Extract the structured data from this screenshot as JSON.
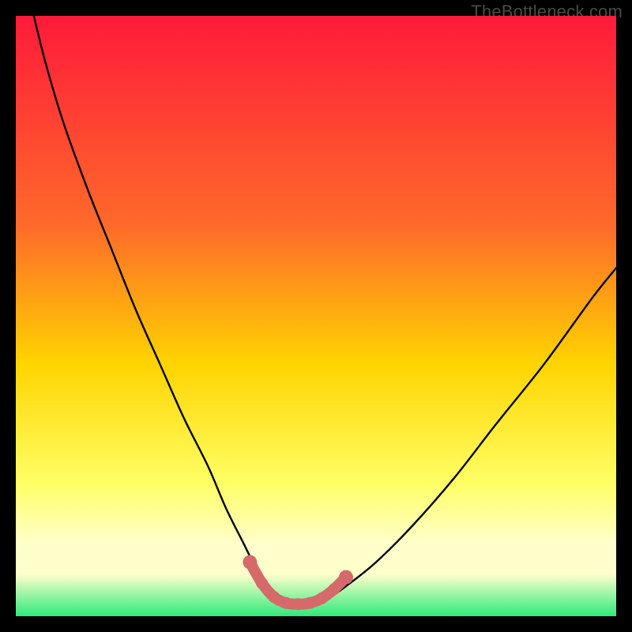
{
  "watermark": "TheBottleneck.com",
  "colors": {
    "frame": "#000000",
    "grad_top": "#ff1a3a",
    "grad_mid1": "#ff6a2a",
    "grad_mid2": "#ffd400",
    "grad_low1": "#ffff66",
    "grad_low2": "#ffffcc",
    "grad_bottom": "#2eea7b",
    "curve": "#000000",
    "highlight": "#d66a6a"
  },
  "chart_data": {
    "type": "line",
    "title": "",
    "xlabel": "",
    "ylabel": "",
    "xlim": [
      0,
      100
    ],
    "ylim": [
      0,
      100
    ],
    "series": [
      {
        "name": "bottleneck-curve",
        "x": [
          3,
          5,
          8,
          12,
          16,
          20,
          24,
          28,
          32,
          35,
          38,
          40,
          42,
          44,
          46,
          49,
          52,
          55,
          60,
          66,
          73,
          80,
          88,
          96,
          100
        ],
        "y": [
          100,
          92,
          82,
          71,
          61,
          51,
          42,
          33,
          25,
          18,
          12,
          8,
          5,
          3,
          2,
          2,
          3,
          5,
          9,
          15,
          23,
          32,
          42,
          53,
          58
        ]
      }
    ],
    "highlight_region": {
      "name": "sweet-spot",
      "x": [
        39,
        41,
        43,
        45,
        47,
        49,
        51,
        53,
        55
      ],
      "y": [
        9,
        5.5,
        3.2,
        2.2,
        2,
        2.2,
        3.0,
        4.5,
        6.5
      ]
    },
    "gradient_stops_pct": [
      0,
      35,
      58,
      78,
      88,
      93,
      100
    ]
  }
}
